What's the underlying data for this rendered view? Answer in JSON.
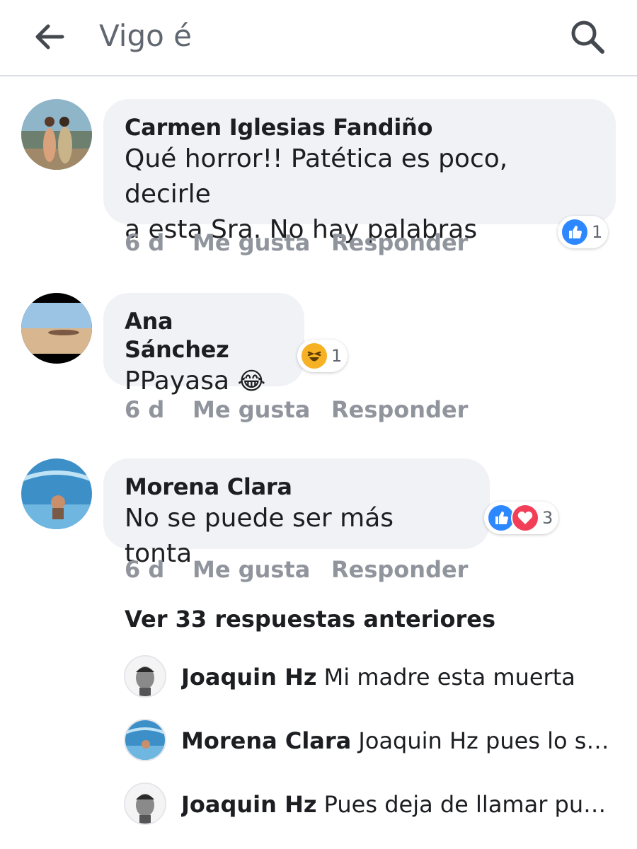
{
  "header": {
    "back_icon": "back-arrow-icon",
    "search_text": "Vigo é",
    "search_icon": "search-icon"
  },
  "comments": [
    {
      "author": "Carmen Iglesias Fandiño",
      "text_line1": "Qué horror!! Patética es poco, decirle",
      "text_line2": "a esta Sra. No hay palabras",
      "time": "6 d",
      "like_label": "Me gusta",
      "reply_label": "Responder",
      "reactions": [
        "like"
      ],
      "reaction_count": "1"
    },
    {
      "author": "Ana Sánchez",
      "text": "PPayasa",
      "emoji": "😂",
      "time": "6 d",
      "like_label": "Me gusta",
      "reply_label": "Responder",
      "reactions": [
        "haha"
      ],
      "reaction_count": "1"
    },
    {
      "author": "Morena Clara",
      "text": "No se puede ser más tonta",
      "time": "6 d",
      "like_label": "Me gusta",
      "reply_label": "Responder",
      "reactions": [
        "like",
        "love"
      ],
      "reaction_count": "3"
    }
  ],
  "view_more": "Ver 33 respuestas anteriores",
  "replies": [
    {
      "author": "Joaquin Hz",
      "text": "Mi madre esta muerta"
    },
    {
      "author": "Morena Clara",
      "text": "Joaquin Hz pues lo sient…"
    },
    {
      "author": "Joaquin Hz",
      "text": "Pues deja de llamar puta a…"
    }
  ],
  "colors": {
    "like_blue": "#2d88ff",
    "love_red": "#f33e58",
    "haha_yellow": "#f7b125",
    "bubble_bg": "#f0f2f5",
    "meta_gray": "#90949c"
  }
}
